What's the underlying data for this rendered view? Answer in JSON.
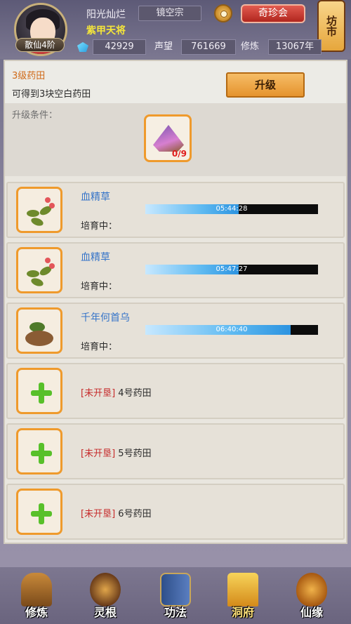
{
  "header": {
    "player_name": "阳光灿烂",
    "title": "紫甲天将",
    "rank": "散仙4阶",
    "sect": "镜空宗",
    "treasure_button": "奇珍会",
    "market_button": "坊市",
    "gems": "42929",
    "reputation_label": "声望",
    "reputation": "761669",
    "cultivation_label": "修炼",
    "cultivation": "13067年"
  },
  "upgrade": {
    "level_label": "3级药田",
    "description": "可得到3块空白药田",
    "upgrade_button": "升级",
    "conditions_label": "升级条件：",
    "material_count": "0/9"
  },
  "plots": [
    {
      "name": "血精草",
      "status": "培育中：",
      "timer": "05:44:28",
      "progress": 0.54
    },
    {
      "name": "血精草",
      "status": "培育中：",
      "timer": "05:47:27",
      "progress": 0.54
    },
    {
      "name": "千年何首乌",
      "status": "培育中：",
      "timer": "06:40:40",
      "progress": 0.84
    }
  ],
  "locked_plots": [
    {
      "tag": "[未开垦]",
      "name": "4号药田"
    },
    {
      "tag": "[未开垦]",
      "name": "5号药田"
    },
    {
      "tag": "[未开垦]",
      "name": "6号药田"
    }
  ],
  "nav": {
    "items": [
      "修炼",
      "灵根",
      "功法",
      "洞府",
      "仙缘"
    ]
  },
  "icons": {
    "gear": "gear-icon",
    "gem": "gem-icon",
    "plus": "plus-icon"
  },
  "colors": {
    "accent_orange": "#ef9a2c",
    "herb_name_blue": "#3574c9",
    "locked_red": "#c62b2b",
    "title_yellow": "#f4e53a"
  }
}
